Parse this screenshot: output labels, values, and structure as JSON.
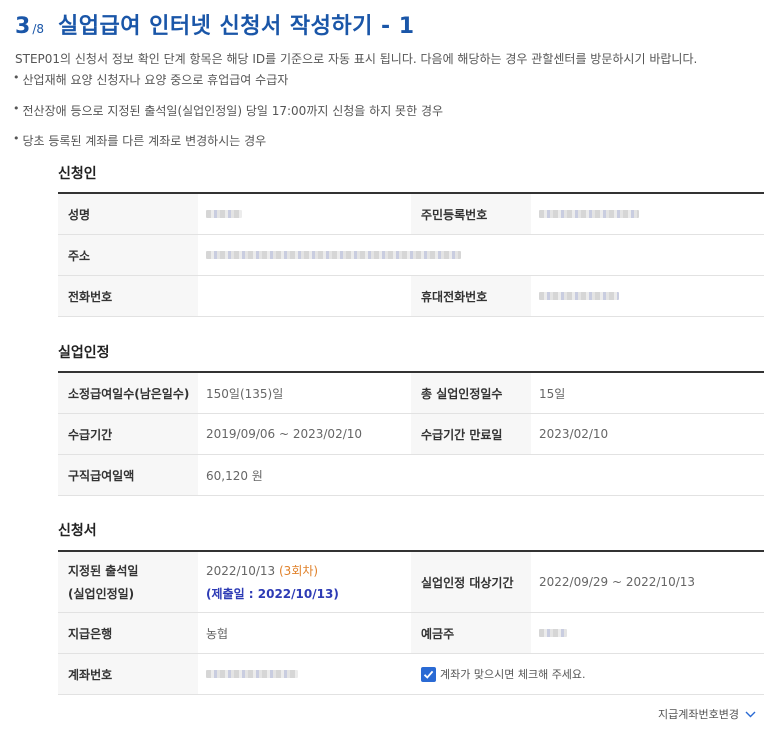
{
  "header": {
    "step_current": "3",
    "step_total": "/8",
    "title": "실업급여 인터넷 신청서 작성하기 - 1"
  },
  "intro": "STEP01의 신청서 정보 확인 단계 항목은 해당 ID를 기준으로 자동 표시 됩니다. 다음에 해당하는 경우 관할센터를 방문하시기 바랍니다.",
  "notes": [
    "산업재해 요양 신청자나 요양 중으로 휴업급여 수급자",
    "전산장애 등으로 지정된 출석일(실업인정일) 당일 17:00까지 신청을 하지 못한 경우",
    "당초 등록된 계좌를 다른 계좌로 변경하시는 경우"
  ],
  "applicant": {
    "section_title": "신청인",
    "name_label": "성명",
    "rrn_label": "주민등록번호",
    "address_label": "주소",
    "phone_label": "전화번호",
    "phone_value": "",
    "mobile_label": "휴대전화번호"
  },
  "unemployment": {
    "section_title": "실업인정",
    "days_label": "소정급여일수(남은일수)",
    "days_value": "150일(135)일",
    "total_label": "총 실업인정일수",
    "total_value": "15일",
    "period_label": "수급기간",
    "period_value": "2019/09/06 ~ 2023/02/10",
    "expiry_label": "수급기간 만료일",
    "expiry_value": "2023/02/10",
    "daily_label": "구직급여일액",
    "daily_value": "60,120 원"
  },
  "application": {
    "section_title": "신청서",
    "attend_label_1": "지정된 출석일",
    "attend_label_2": "(실업인정일)",
    "attend_date": "2022/10/13",
    "attend_count": "(3회차)",
    "submit_date": "(제출일 : 2022/10/13)",
    "target_label": "실업인정 대상기간",
    "target_value": "2022/09/29  ~  2022/10/13",
    "bank_label": "지급은행",
    "bank_value": "농협",
    "holder_label": "예금주",
    "account_label": "계좌번호",
    "confirm_text": "계좌가 맞으시면 체크해 주세요.",
    "confirm_checked": true
  },
  "footer": {
    "change_account": "지급계좌번호변경"
  }
}
